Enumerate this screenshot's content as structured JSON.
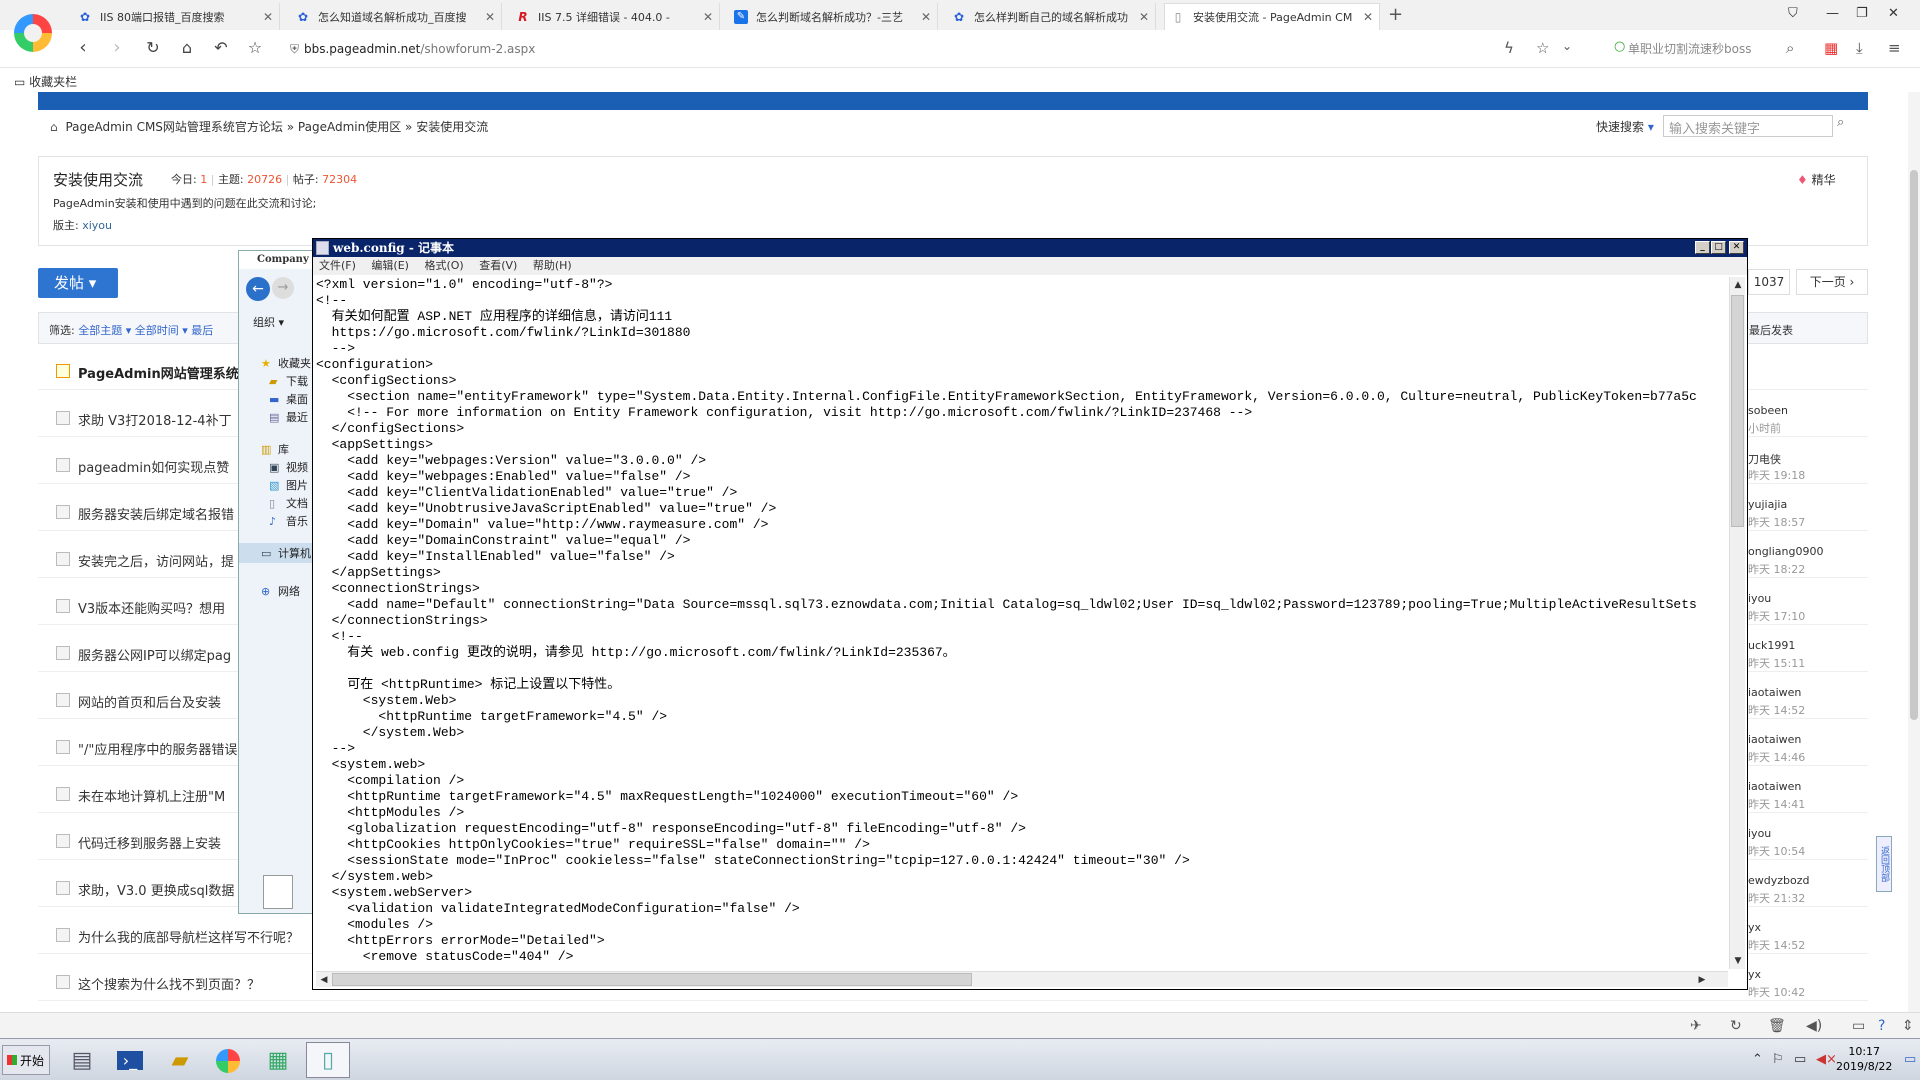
{
  "browser": {
    "tabs": [
      {
        "title": "IIS 80端口报错_百度搜索",
        "favicon": "baidu-paw-icon",
        "color": "#2a5fd8"
      },
      {
        "title": "怎么知道域名解析成功_百度搜",
        "favicon": "baidu-paw-icon",
        "color": "#2a5fd8"
      },
      {
        "title": "IIS 7.5 详细错误 - 404.0 -",
        "favicon": "R",
        "color": "#d71921"
      },
      {
        "title": "怎么判断域名解析成功？-三艺",
        "favicon": "pen-icon",
        "color": "#1a73e8"
      },
      {
        "title": "怎么样判断自己的域名解析成功",
        "favicon": "baidu-paw-icon",
        "color": "#2a5fd8"
      },
      {
        "title": "安装使用交流 - PageAdmin CM",
        "favicon": "page-icon",
        "color": "#666666",
        "active": true
      }
    ],
    "new_tab": "+",
    "url_prefix": "bbs.pageadmin.net",
    "url_path": "/showforum-2.aspx",
    "search_placeholder": "单职业切割流速秒boss",
    "bookmarks_label": "收藏夹栏"
  },
  "forum": {
    "breadcrumb": [
      "PageAdmin CMS网站管理系统官方论坛",
      "»",
      "PageAdmin使用区",
      "»",
      "安装使用交流"
    ],
    "quick_search": "快速搜索",
    "search_placeholder": "输入搜索关键字",
    "title": "安装使用交流",
    "today_label": "今日:",
    "today": "1",
    "topics_label": "主题:",
    "topics": "20726",
    "posts_label": "帖子:",
    "posts": "72304",
    "description": "PageAdmin安装和使用中遇到的问题在此交流和讨论;",
    "moderator_label": "版主:",
    "moderator": "xiyou",
    "digest": "精华",
    "post_button": "发帖 ▾",
    "pager_total": "1037",
    "pager_next": "下一页 ›",
    "filter": {
      "label": "筛选:",
      "all_topics": "全部主题 ▾",
      "all_time": "全部时间 ▾",
      "latest": "最后",
      "last_post": "最后发表"
    },
    "threads": [
      {
        "title": "PageAdmin网站管理系统",
        "author": "",
        "time": "",
        "pinned": true
      },
      {
        "title": "求助 V3打2018-12-4补丁",
        "author": "sobeen",
        "time": "小时前"
      },
      {
        "title": "pageadmin如何实现点赞",
        "author": "刀电侠",
        "time": "昨天 19:18"
      },
      {
        "title": "服务器安装后绑定域名报错",
        "author": "yujiajia",
        "time": "昨天 18:57"
      },
      {
        "title": "安装完之后，访问网站，提",
        "author": "ongliang0900",
        "time": "昨天 18:22"
      },
      {
        "title": "V3版本还能购买吗？想用",
        "author": "iyou",
        "time": "昨天 17:10"
      },
      {
        "title": "服务器公网IP可以绑定pag",
        "author": "uck1991",
        "time": "昨天 15:11"
      },
      {
        "title": "网站的首页和后台及安装",
        "author": "iaotaiwen",
        "time": "昨天 14:52"
      },
      {
        "title": "\"/\"应用程序中的服务器错误",
        "author": "iaotaiwen",
        "time": "昨天 14:46"
      },
      {
        "title": "未在本地计算机上注册\"M",
        "author": "iaotaiwen",
        "time": "昨天 14:41"
      },
      {
        "title": "代码迁移到服务器上安装",
        "author": "iyou",
        "time": "昨天 10:54"
      },
      {
        "title": "求助，V3.0 更换成sql数据",
        "author": "ewdyzbozd",
        "time": "昨天 21:32"
      },
      {
        "title": "为什么我的底部导航栏这样写不行呢？",
        "author": "yx",
        "time": "昨天 14:52"
      },
      {
        "title": "这个搜索为什么找不到页面？？",
        "author": "yx",
        "time": "昨天 10:42"
      }
    ],
    "side_float": "返回顶部"
  },
  "explorer": {
    "title": "Company",
    "organize": "组织 ▾",
    "items": [
      "收藏夹",
      "下载",
      "桌面",
      "最近",
      "库",
      "视频",
      "图片",
      "文档",
      "音乐",
      "计算机",
      "网络"
    ]
  },
  "notepad": {
    "title": "web.config - 记事本",
    "menu": [
      "文件(F)",
      "编辑(E)",
      "格式(O)",
      "查看(V)",
      "帮助(H)"
    ],
    "lines": [
      "<?xml version=\"1.0\" encoding=\"utf-8\"?>",
      "<!--",
      "  有关如何配置 ASP.NET 应用程序的详细信息，请访问111",
      "  https://go.microsoft.com/fwlink/?LinkId=301880",
      "  -->",
      "<configuration>",
      "  <configSections>",
      "    <section name=\"entityFramework\" type=\"System.Data.Entity.Internal.ConfigFile.EntityFrameworkSection, EntityFramework, Version=6.0.0.0, Culture=neutral, PublicKeyToken=b77a5c",
      "    <!-- For more information on Entity Framework configuration, visit http://go.microsoft.com/fwlink/?LinkID=237468 -->",
      "  </configSections>",
      "  <appSettings>",
      "    <add key=\"webpages:Version\" value=\"3.0.0.0\" />",
      "    <add key=\"webpages:Enabled\" value=\"false\" />",
      "    <add key=\"ClientValidationEnabled\" value=\"true\" />",
      "    <add key=\"UnobtrusiveJavaScriptEnabled\" value=\"true\" />",
      "    <add key=\"Domain\" value=\"http://www.raymeasure.com\" />",
      "    <add key=\"DomainConstraint\" value=\"equal\" />",
      "    <add key=\"InstallEnabled\" value=\"false\" />",
      "  </appSettings>",
      "  <connectionStrings>",
      "    <add name=\"Default\" connectionString=\"Data Source=mssql.sql73.eznowdata.com;Initial Catalog=sq_ldwl02;User ID=sq_ldwl02;Password=123789;pooling=True;MultipleActiveResultSets",
      "  </connectionStrings>",
      "  <!--",
      "    有关 web.config 更改的说明，请参见 http://go.microsoft.com/fwlink/?LinkId=235367。",
      "",
      "    可在 <httpRuntime> 标记上设置以下特性。",
      "      <system.Web>",
      "        <httpRuntime targetFramework=\"4.5\" />",
      "      </system.Web>",
      "  -->",
      "  <system.web>",
      "    <compilation />",
      "    <httpRuntime targetFramework=\"4.5\" maxRequestLength=\"1024000\" executionTimeout=\"60\" />",
      "    <httpModules />",
      "    <globalization requestEncoding=\"utf-8\" responseEncoding=\"utf-8\" fileEncoding=\"utf-8\" />",
      "    <httpCookies httpOnlyCookies=\"true\" requireSSL=\"false\" domain=\"\" />",
      "    <sessionState mode=\"InProc\" cookieless=\"false\" stateConnectionString=\"tcpip=127.0.0.1:42424\" timeout=\"30\" />",
      "  </system.web>",
      "  <system.webServer>",
      "    <validation validateIntegratedModeConfiguration=\"false\" />",
      "    <modules />",
      "    <httpErrors errorMode=\"Detailed\">",
      "      <remove statusCode=\"404\" />"
    ]
  },
  "taskbar": {
    "start": "开始",
    "time": "10:17",
    "date": "2019/8/22"
  }
}
